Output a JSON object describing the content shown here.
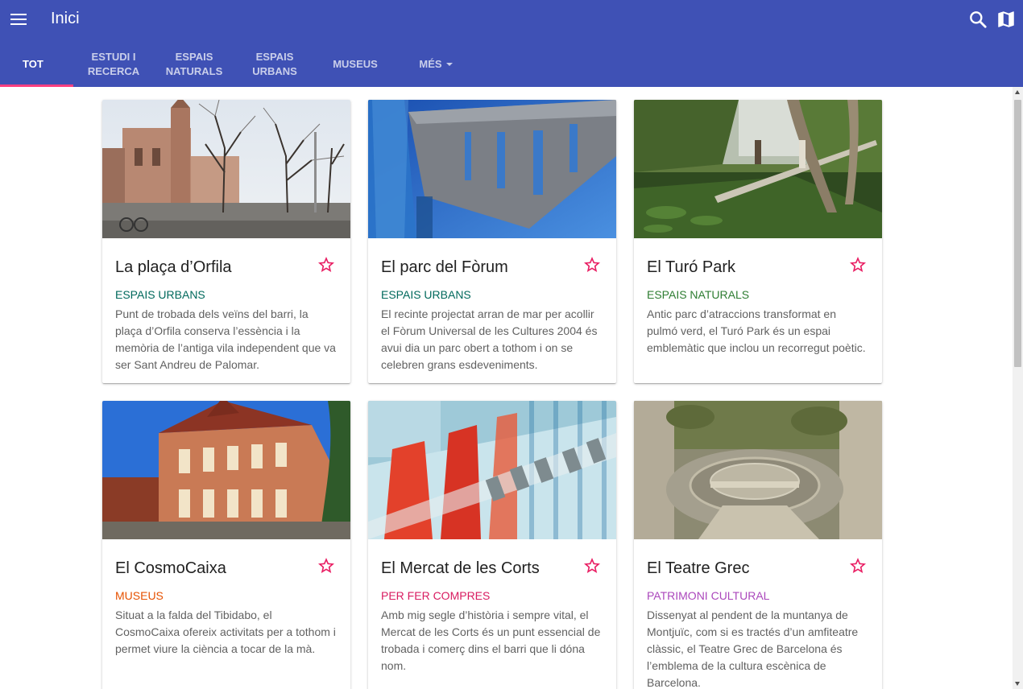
{
  "appbar": {
    "title": "Inici",
    "color": "#3f51b5",
    "icons": [
      "menu-icon",
      "search-icon",
      "map-icon"
    ]
  },
  "tabs": [
    {
      "label": "TOT",
      "active": true
    },
    {
      "label": "ESTUDI I RECERCA"
    },
    {
      "label": "ESPAIS NATURALS"
    },
    {
      "label": "ESPAIS URBANS"
    },
    {
      "label": "MUSEUS"
    },
    {
      "label": "MÉS",
      "dropdown": true
    }
  ],
  "accent": "#ff4081",
  "cards": [
    {
      "title": "La plaça d’Orfila",
      "category": "ESPAIS URBANS",
      "category_color": "#00695c",
      "description": "Punt de trobada dels veïns del barri, la plaça d’Orfila conserva l’essència i la memòria de l’antiga vila independent que va ser Sant Andreu de Palomar."
    },
    {
      "title": "El parc del Fòrum",
      "category": "ESPAIS URBANS",
      "category_color": "#00695c",
      "description": "El recinte projectat arran de mar per acollir el Fòrum Universal de les Cultures 2004 és avui dia un parc obert a tothom i on se celebren grans esdeveniments."
    },
    {
      "title": "El Turó Park",
      "category": "ESPAIS NATURALS",
      "category_color": "#2e7d32",
      "description": "Antic parc d’atraccions transformat en pulmó verd, el Turó Park és un espai emblemàtic que inclou un recorregut poètic."
    },
    {
      "title": "El CosmoCaixa",
      "category": "MUSEUS",
      "category_color": "#e65100",
      "description": "Situat a la falda del Tibidabo, el CosmoCaixa ofereix activitats per a tothom i permet viure la ciència a tocar de la mà."
    },
    {
      "title": "El Mercat de les Corts",
      "category": "PER FER COMPRES",
      "category_color": "#d81b60",
      "description": "Amb mig segle d’història i sempre vital, el Mercat de les Corts és un punt essencial de trobada i comerç dins el barri que li dóna nom."
    },
    {
      "title": "El Teatre Grec",
      "category": "PATRIMONI CULTURAL",
      "category_color": "#ab47bc",
      "description": "Dissenyat al pendent de la muntanya de Montjuïc, com si es tractés d’un amfiteatre clàssic, el Teatre Grec de Barcelona és l’emblema de la cultura escènica de Barcelona."
    }
  ],
  "star_icon": "star-outline-icon",
  "star_color": "#e91e63"
}
